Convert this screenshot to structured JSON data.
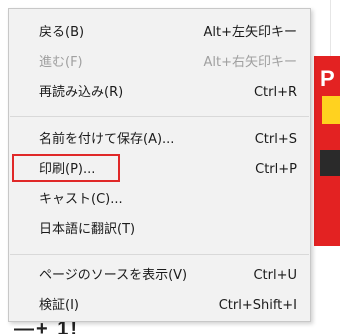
{
  "background": {
    "side_letter": "P",
    "bottom_text": "—+ 1!"
  },
  "menu": {
    "items": [
      {
        "label": "戻る(B)",
        "shortcut": "Alt+左矢印キー",
        "disabled": false
      },
      {
        "label": "進む(F)",
        "shortcut": "Alt+右矢印キー",
        "disabled": true
      },
      {
        "label": "再読み込み(R)",
        "shortcut": "Ctrl+R",
        "disabled": false
      },
      {
        "label": "名前を付けて保存(A)...",
        "shortcut": "Ctrl+S",
        "disabled": false
      },
      {
        "label": "印刷(P)...",
        "shortcut": "Ctrl+P",
        "disabled": false
      },
      {
        "label": "キャスト(C)...",
        "shortcut": "",
        "disabled": false
      },
      {
        "label": "日本語に翻訳(T)",
        "shortcut": "",
        "disabled": false
      },
      {
        "label": "ページのソースを表示(V)",
        "shortcut": "Ctrl+U",
        "disabled": false
      },
      {
        "label": "検証(I)",
        "shortcut": "Ctrl+Shift+I",
        "disabled": false
      }
    ]
  },
  "colors": {
    "highlight_border": "#e02828",
    "menu_background": "#f2f2f2",
    "disabled_text": "#a0a0a0"
  }
}
